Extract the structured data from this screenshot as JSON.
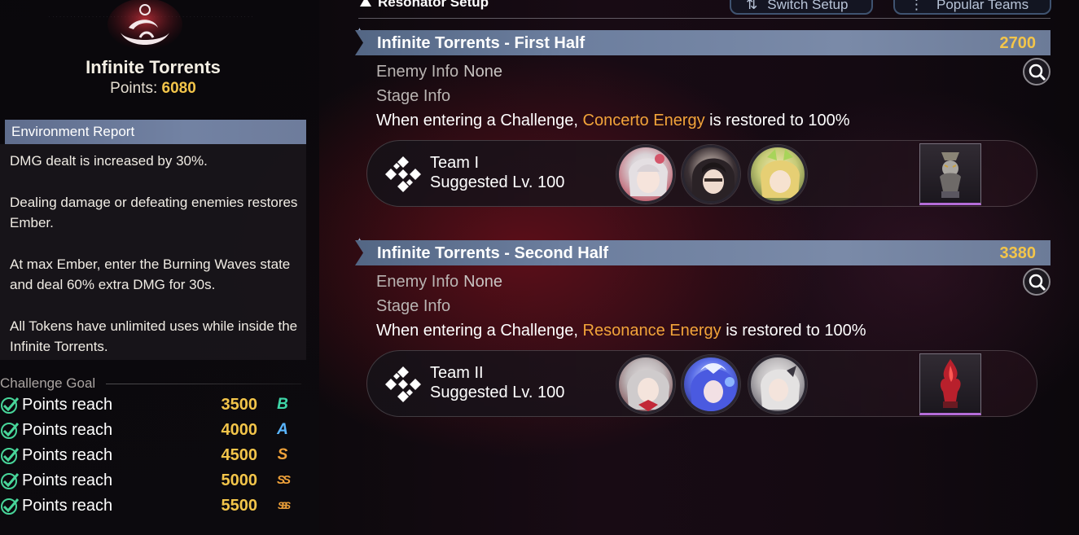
{
  "left": {
    "title": "Infinite Torrents",
    "points_label": "Points:",
    "points_value": "6080",
    "environment": {
      "header": "Environment Report",
      "paragraphs": [
        "DMG dealt is increased by 30%.",
        "Dealing damage or defeating enemies restores Ember.",
        "At max Ember, enter the Burning Waves state and deal 60% extra DMG for 30s.",
        "All Tokens have unlimited uses while inside the Infinite Torrents."
      ]
    },
    "challenge_goal": {
      "title": "Challenge Goal",
      "goals": [
        {
          "label": "Points reach",
          "points": "3500",
          "rank": "B",
          "color": "#3fd6a8"
        },
        {
          "label": "Points reach",
          "points": "4000",
          "rank": "A",
          "color": "#5ab6ff"
        },
        {
          "label": "Points reach",
          "points": "4500",
          "rank": "S",
          "color": "#f0a23a"
        },
        {
          "label": "Points reach",
          "points": "5000",
          "rank": "SS",
          "color": "#f0a23a"
        },
        {
          "label": "Points reach",
          "points": "5500",
          "rank": "SSS",
          "color": "#f0a23a"
        }
      ]
    }
  },
  "top": {
    "resonator_setup": "Resonator Setup",
    "switch_setup": "Switch Setup",
    "popular_teams": "Popular Teams"
  },
  "stages": [
    {
      "name": "Infinite Torrents - First Half",
      "score": "2700",
      "enemy_info_label": "Enemy Info",
      "enemy_info_value": "None",
      "stage_info_label": "Stage Info",
      "desc_prefix": "When entering a Challenge,",
      "desc_highlight": "Concerto Energy",
      "desc_suffix": "is restored to 100%",
      "team": {
        "name": "Team I",
        "level": "Suggested Lv. 100"
      }
    },
    {
      "name": "Infinite Torrents - Second Half",
      "score": "3380",
      "enemy_info_label": "Enemy Info",
      "enemy_info_value": "None",
      "stage_info_label": "Stage Info",
      "desc_prefix": "When entering a Challenge,",
      "desc_highlight": "Resonance Energy",
      "desc_suffix": "is restored to 100%",
      "team": {
        "name": "Team II",
        "level": "Suggested Lv. 100"
      }
    }
  ],
  "colors": {
    "gold": "#f3c54a",
    "highlight_orange": "#f2a43a",
    "header_blue": "#6c7e9e"
  },
  "icons": {
    "search": "magnifier-icon",
    "team": "diamond-cluster-icon",
    "check": "check-circle-icon"
  }
}
